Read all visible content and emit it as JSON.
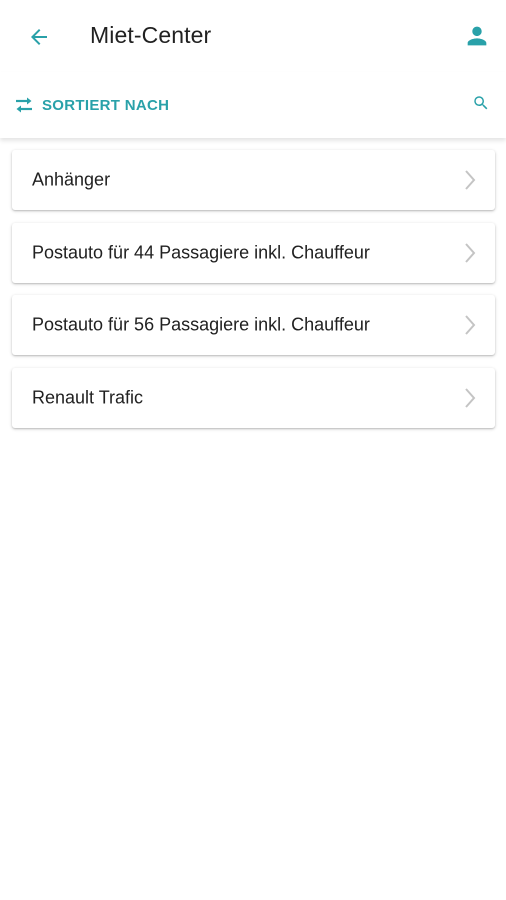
{
  "header": {
    "title": "Miet-Center",
    "back_icon": "arrow-left-icon",
    "account_icon": "person-icon"
  },
  "toolbar": {
    "sort_label": "SORTIERT NACH",
    "sort_icon": "swap-horizontal-icon",
    "search_icon": "search-icon"
  },
  "list": {
    "items": [
      {
        "label": "Anhänger"
      },
      {
        "label": "Postauto für 44 Passagiere inkl. Chauffeur"
      },
      {
        "label": "Postauto für 56 Passagiere inkl. Chauffeur"
      },
      {
        "label": "Renault Trafic"
      }
    ],
    "chevron_icon": "chevron-right-icon"
  },
  "colors": {
    "accent": "#29a1a9",
    "text": "#212121",
    "chevron": "#c4c4c4",
    "background": "#ffffff"
  }
}
